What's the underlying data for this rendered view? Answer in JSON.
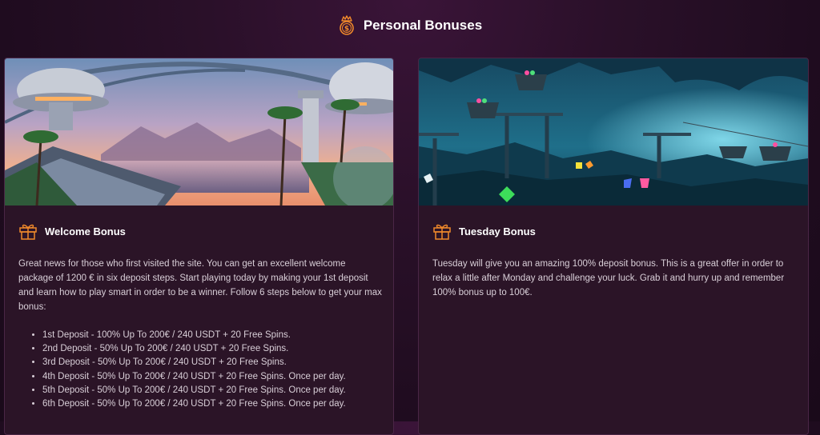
{
  "header": {
    "title": "Personal Bonuses",
    "icon": "crown-coin-icon"
  },
  "colors": {
    "background": "#1f0c1f",
    "card": "#2b1427",
    "accent": "#f0892b"
  },
  "cards": [
    {
      "title": "Welcome Bonus",
      "icon": "gift-icon",
      "description": "Great news for those who first visited the site. You can get an excellent welcome package of 1200 € in six deposit steps. Start playing today by making your 1st deposit and learn how to play smart in order to be a winner. Follow 6 steps below to get your max bonus:",
      "items": [
        "1st Deposit - 100% Up To 200€ / 240 USDT + 20 Free Spins.",
        "2nd Deposit - 50% Up To 200€ / 240 USDT + 20 Free Spins.",
        "3rd Deposit - 50% Up To 200€ / 240 USDT + 20 Free Spins.",
        "4th Deposit - 50% Up To 200€ / 240 USDT + 20 Free Spins. Once per day.",
        "5th Deposit - 50% Up To 200€ / 240 USDT + 20 Free Spins. Once per day.",
        "6th Deposit - 50% Up To 200€ / 240 USDT + 20 Free Spins. Once per day."
      ]
    },
    {
      "title": "Tuesday Bonus",
      "icon": "gift-icon",
      "description": "Tuesday will give you an amazing 100% deposit bonus. This is a great offer in order to relax a little after Monday and challenge your luck. Grab it and hurry up and remember 100% bonus up to 100€."
    }
  ]
}
